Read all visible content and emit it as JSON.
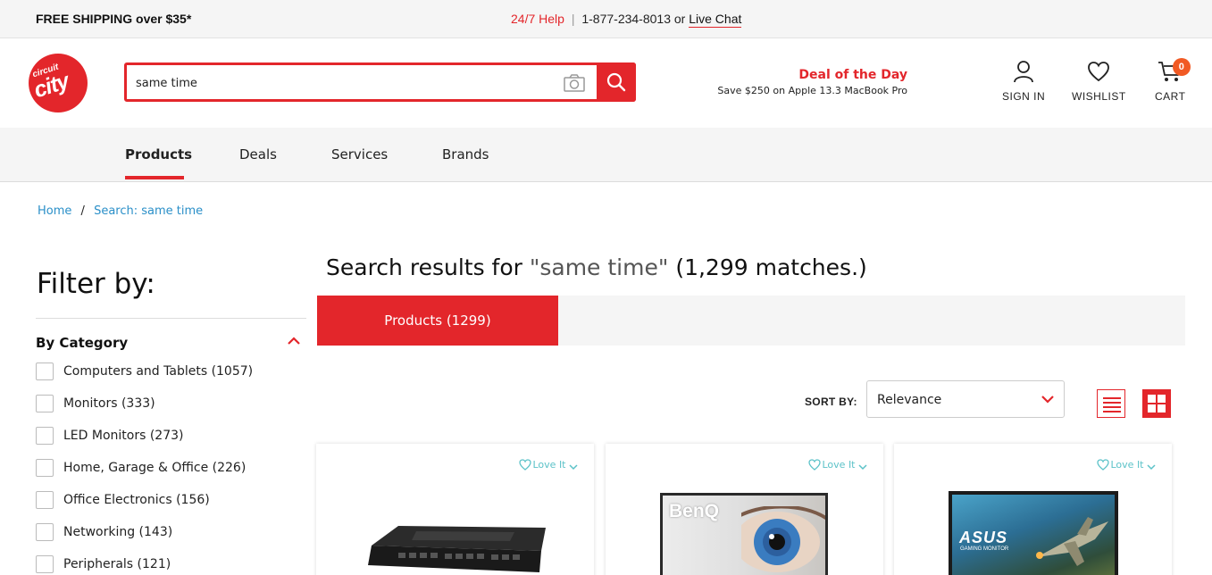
{
  "topbar": {
    "shipping": "FREE SHIPPING over $35*",
    "help_label": "24/7 Help",
    "separator": "|",
    "phone": "1-877-234-8013",
    "or": "or",
    "live_chat": "Live Chat"
  },
  "logo": {
    "small": "circuit",
    "big": "city"
  },
  "search": {
    "value": "same time",
    "camera_icon": "camera-icon",
    "submit_icon": "search-icon"
  },
  "deal": {
    "title": "Deal of the Day",
    "subtitle": "Save $250 on Apple 13.3 MacBook Pro"
  },
  "header_actions": {
    "sign_in": "SIGN IN",
    "wishlist": "WISHLIST",
    "cart": "CART",
    "cart_count": "0"
  },
  "nav": {
    "items": [
      {
        "label": "Products"
      },
      {
        "label": "Deals"
      },
      {
        "label": "Services"
      },
      {
        "label": "Brands"
      }
    ]
  },
  "breadcrumb": {
    "home": "Home",
    "separator": "/",
    "current": "Search: same time"
  },
  "filter": {
    "title": "Filter by:",
    "category_heading": "By Category",
    "categories": [
      {
        "label": "Computers and Tablets (1057)"
      },
      {
        "label": "Monitors (333)"
      },
      {
        "label": "LED Monitors (273)"
      },
      {
        "label": "Home, Garage & Office (226)"
      },
      {
        "label": "Office Electronics (156)"
      },
      {
        "label": "Networking (143)"
      },
      {
        "label": "Peripherals (121)"
      }
    ]
  },
  "results": {
    "prefix": "Search results for ",
    "query": "\"same time\"",
    "suffix": " (1,299 matches.)",
    "tab_label": "Products (1299)"
  },
  "sort": {
    "label": "SORT BY:",
    "value": "Relevance"
  },
  "products": [
    {
      "love_label": "Love It",
      "image": "network-switch"
    },
    {
      "love_label": "Love It",
      "image": "benq-monitor",
      "brand": "BenQ"
    },
    {
      "love_label": "Love It",
      "image": "asus-gaming-monitor",
      "brand": "ASUS",
      "tagline": "GAMING MONITOR"
    }
  ],
  "colors": {
    "accent": "#e3262b",
    "link": "#2a8fc8",
    "love": "#5bc2c8",
    "badge": "#f15a24"
  }
}
